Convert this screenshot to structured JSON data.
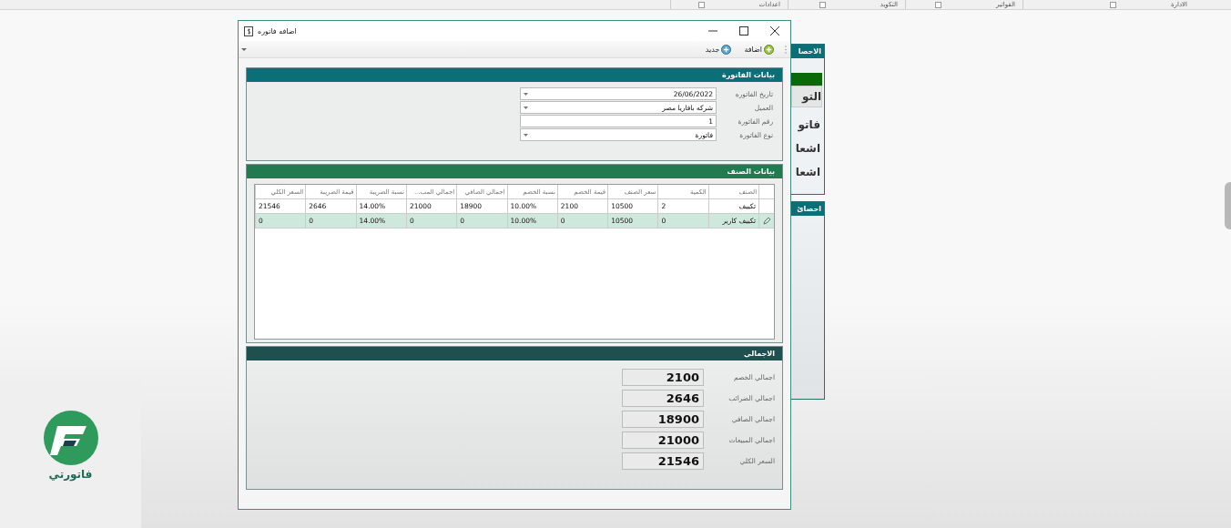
{
  "menu_bar": {
    "items": [
      {
        "label": "الادارة"
      },
      {
        "label": "الفواتير"
      },
      {
        "label": "التكويد"
      },
      {
        "label": "اعدادات"
      }
    ]
  },
  "side_panels": [
    {
      "title": "الاحصا",
      "button": "التو",
      "items": [
        "فاتو",
        "اشعا",
        "اشعا"
      ]
    },
    {
      "title": "احصائ"
    }
  ],
  "window": {
    "title": "اضافه فاتوره"
  },
  "toolbar": [
    {
      "label": "اضافة",
      "kind": "add"
    },
    {
      "label": "جديد",
      "kind": "new"
    }
  ],
  "invoice_section": {
    "title": "بيانات الفاتورة",
    "fields": [
      {
        "label": "تاريخ الفاتوره",
        "value": "26/06/2022",
        "kind": "dropdown"
      },
      {
        "label": "العميل",
        "value": "شركه بافاريا مصر",
        "kind": "dropdown"
      },
      {
        "label": "رقم الفاتورة",
        "value": "1",
        "kind": "text"
      },
      {
        "label": "نوع الفاتورة",
        "value": "فاتورة",
        "kind": "dropdown"
      }
    ]
  },
  "items_section": {
    "title": "بيانات الصنف",
    "columns": [
      "الصنف",
      "الكمية",
      "سعر الصنف",
      "قيمة الخصم",
      "نسبة الخصم",
      "اجمالي الصافي",
      "اجمالي المب...",
      "نسبة الضريبة",
      "قيمة الضريبة",
      "السعر الكلي"
    ],
    "rows": [
      {
        "selected": false,
        "editing": false,
        "cells": [
          "تكييف",
          "2",
          "10500",
          "2100",
          "10.00%",
          "18900",
          "21000",
          "14.00%",
          "2646",
          "21546"
        ]
      },
      {
        "selected": true,
        "editing": true,
        "cells": [
          "تكييف كارير",
          "0",
          "10500",
          "0",
          "10.00%",
          "0",
          "0",
          "14.00%",
          "0",
          "0"
        ]
      }
    ]
  },
  "totals_section": {
    "title": "الاجمالي",
    "rows": [
      {
        "label": "اجمالي الخصم",
        "value": "2100"
      },
      {
        "label": "اجمالي الضرائب",
        "value": "2646"
      },
      {
        "label": "اجمالي الصافي",
        "value": "18900"
      },
      {
        "label": "اجمالي المبيعات",
        "value": "21000"
      },
      {
        "label": "السعر الكلي",
        "value": "21546"
      }
    ]
  },
  "logo": {
    "name": "فاتورتي"
  }
}
